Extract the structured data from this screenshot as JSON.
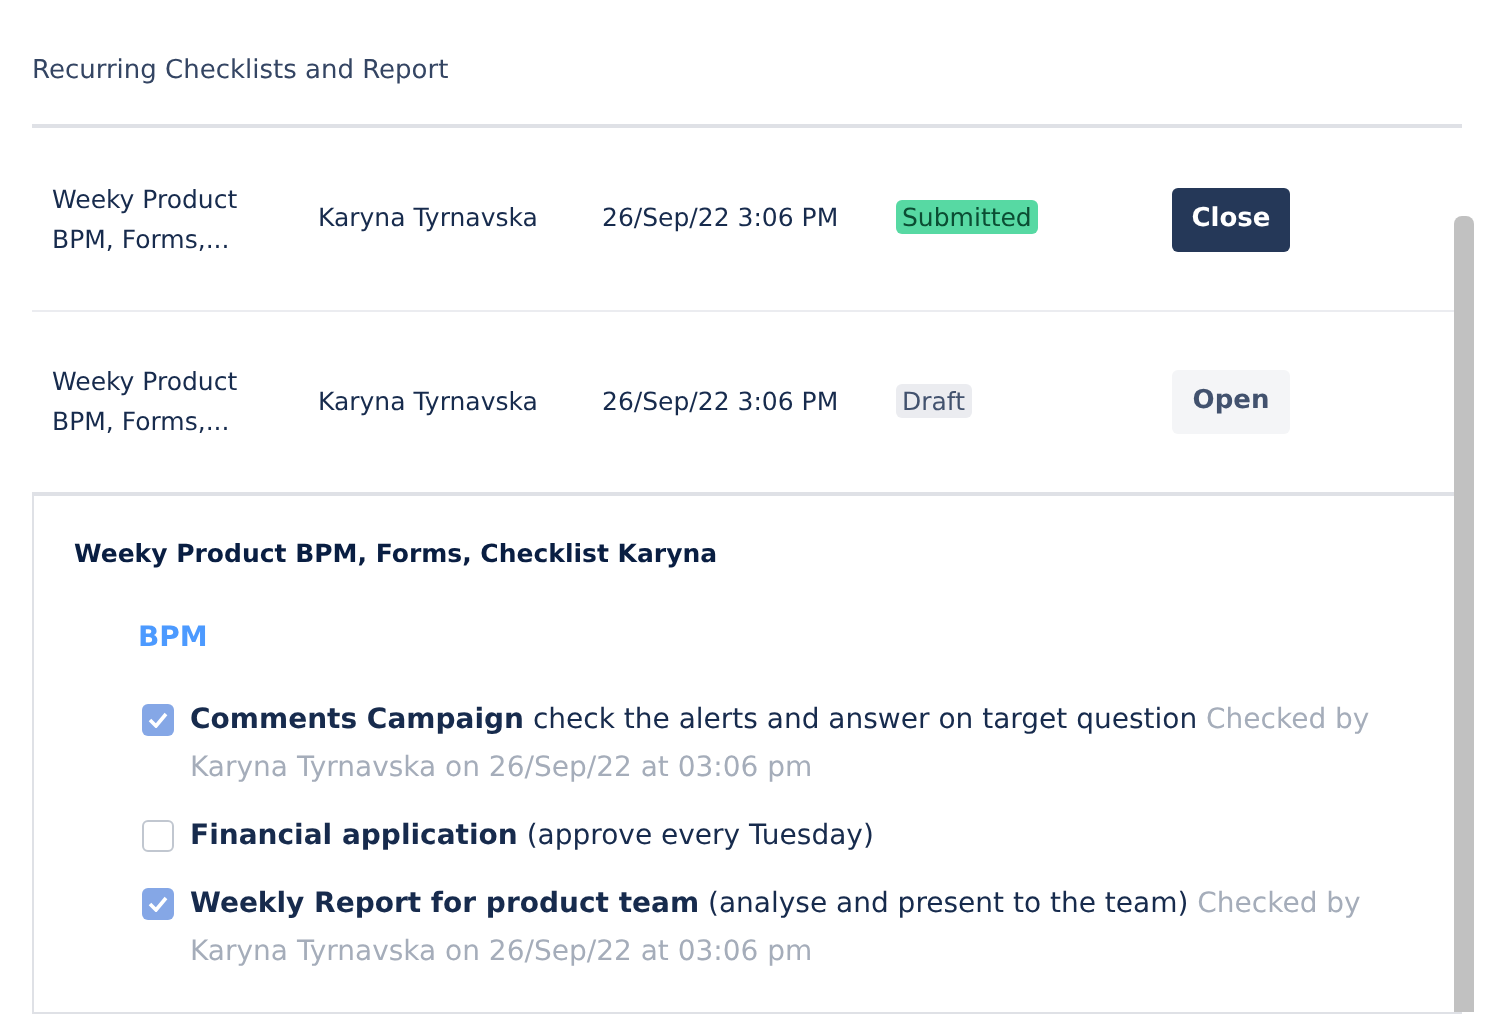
{
  "section_title": "Recurring Checklists and Report",
  "rows": [
    {
      "name": "Weeky Product BPM, Forms,...",
      "user": "Karyna Tyrnavska",
      "date": "26/Sep/22 3:06 PM",
      "status": {
        "label": "Submitted",
        "kind": "submitted"
      },
      "action": {
        "label": "Close",
        "kind": "primary"
      }
    },
    {
      "name": "Weeky Product BPM, Forms,...",
      "user": "Karyna Tyrnavska",
      "date": "26/Sep/22 3:06 PM",
      "status": {
        "label": "Draft",
        "kind": "draft"
      },
      "action": {
        "label": "Open",
        "kind": "secondary"
      }
    }
  ],
  "detail": {
    "title": "Weeky Product BPM, Forms, Checklist Karyna",
    "group": "BPM",
    "items": [
      {
        "checked": true,
        "title": "Comments Campaign",
        "description": "check the alerts and answer on target question",
        "note": "Checked by Karyna Tyrnavska on 26/Sep/22 at 03:06 pm"
      },
      {
        "checked": false,
        "title": "Financial application",
        "description": "(approve every Tuesday)"
      },
      {
        "checked": true,
        "title": "Weekly Report for product team",
        "description": "(analyse and present to the team) ",
        "note": "Checked by Karyna Tyrnavska on 26/Sep/22 at 03:06 pm"
      }
    ]
  }
}
